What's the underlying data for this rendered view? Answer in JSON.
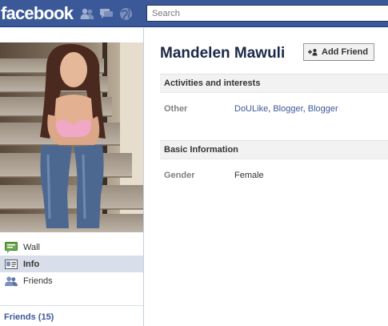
{
  "header": {
    "logo": "facebook",
    "icons": [
      "friend-requests-icon",
      "messages-icon",
      "notifications-icon"
    ],
    "search_placeholder": "Search"
  },
  "sidebar": {
    "items": [
      {
        "label": "Wall",
        "icon": "wall-icon"
      },
      {
        "label": "Info",
        "icon": "info-icon",
        "active": true
      },
      {
        "label": "Friends",
        "icon": "friends-icon"
      }
    ],
    "friends_link": "Friends (15)"
  },
  "profile": {
    "name": "Mandelen Mawuli",
    "add_friend_label": "Add Friend"
  },
  "sections": {
    "activities": {
      "title": "Activities and interests",
      "label": "Other",
      "links": [
        "DoULike",
        "Blogger",
        "Blogger"
      ],
      "separator": ", "
    },
    "basic": {
      "title": "Basic Information",
      "label": "Gender",
      "value": "Female"
    }
  },
  "colors": {
    "brand": "#3b5998",
    "active_nav": "#d8dfea",
    "section_bg": "#f2f2f2"
  }
}
